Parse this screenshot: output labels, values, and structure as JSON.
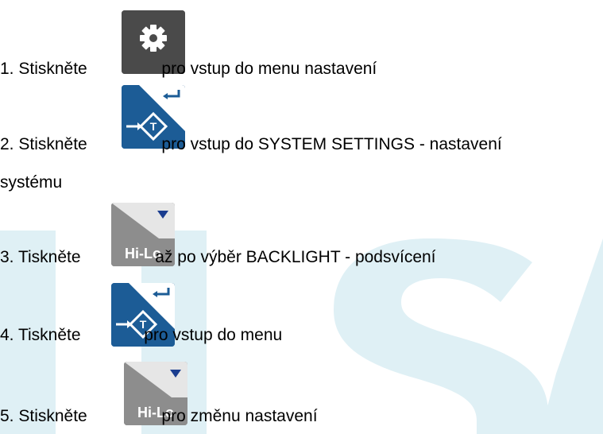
{
  "watermark": {
    "text": "LFSA",
    "color": "#dff0f5"
  },
  "keys": {
    "settings": {
      "icon": "gear-icon"
    },
    "enter": {
      "icon": "enter-tare-icon"
    },
    "hilo": {
      "label": "Hi-Lo",
      "icon": "hi-lo-icon"
    }
  },
  "steps": [
    {
      "prefix": "1. Stiskněte",
      "suffix": "pro vstup do menu nastavení"
    },
    {
      "prefix": "2. Stiskněte",
      "suffix": "pro vstup do SYSTEM SETTINGS  - nastavení",
      "continuation": "systému"
    },
    {
      "prefix": "3. Tiskněte",
      "suffix": "až po výběr BACKLIGHT - podsvícení"
    },
    {
      "prefix": "4. Tiskněte",
      "suffix": "pro vstup do menu"
    },
    {
      "prefix": "5. Stiskněte",
      "suffix": "pro změnu nastavení"
    }
  ],
  "colors": {
    "key_dark": "#4a4a4a",
    "key_blue": "#1c5c96",
    "key_grey": "#8d8d8d",
    "key_navy": "#1a3d8f"
  }
}
